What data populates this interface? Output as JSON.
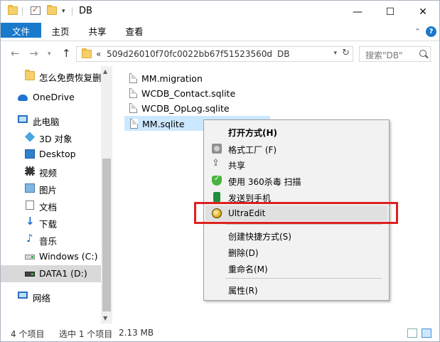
{
  "window": {
    "title": "DB",
    "controls": {
      "minimize": "—",
      "maximize": "☐",
      "close": "✕"
    }
  },
  "ribbon": {
    "tabs": [
      "文件",
      "主页",
      "共享",
      "查看"
    ],
    "collapse_icon": "chevron-up-icon",
    "help": "?"
  },
  "address": {
    "chevron": "«",
    "segments": [
      "509d26010f70fc0022bb67f51523560d",
      "DB"
    ],
    "separator": "›"
  },
  "search": {
    "placeholder": "搜索\"DB\""
  },
  "nav_pane": {
    "items": [
      {
        "label": "怎么免费恢复删",
        "icon": "folder-icon"
      },
      {
        "label": "OneDrive",
        "icon": "onedrive-icon"
      },
      {
        "label": "此电脑",
        "icon": "computer-icon"
      },
      {
        "label": "3D 对象",
        "icon": "3d-objects-icon"
      },
      {
        "label": "Desktop",
        "icon": "desktop-icon"
      },
      {
        "label": "视频",
        "icon": "video-icon"
      },
      {
        "label": "图片",
        "icon": "pictures-icon"
      },
      {
        "label": "文档",
        "icon": "documents-icon"
      },
      {
        "label": "下载",
        "icon": "download-icon"
      },
      {
        "label": "音乐",
        "icon": "music-icon"
      },
      {
        "label": "Windows (C:)",
        "icon": "drive-icon"
      },
      {
        "label": "DATA1 (D:)",
        "icon": "drive-icon",
        "selected": true
      },
      {
        "label": "网络",
        "icon": "network-icon"
      }
    ]
  },
  "files": [
    {
      "name": "MM.migration"
    },
    {
      "name": "WCDB_Contact.sqlite"
    },
    {
      "name": "WCDB_OpLog.sqlite"
    },
    {
      "name": "MM.sqlite",
      "selected": true
    }
  ],
  "context_menu": {
    "items": [
      {
        "label": "打开方式(H)",
        "bold": true,
        "icon": ""
      },
      {
        "label": "格式工厂 (F)",
        "icon": "format-factory-icon"
      },
      {
        "label": "共享",
        "icon": "share-icon"
      },
      {
        "label": "使用 360杀毒 扫描",
        "icon": "360-antivirus-icon"
      },
      {
        "label": "发送到手机",
        "icon": "send-to-phone-icon"
      },
      {
        "label": "UltraEdit",
        "icon": "ultraedit-icon",
        "highlighted": true
      },
      {
        "label": "创建快捷方式(S)",
        "icon": ""
      },
      {
        "label": "删除(D)",
        "icon": ""
      },
      {
        "label": "重命名(M)",
        "icon": ""
      },
      {
        "label": "属性(R)",
        "icon": ""
      }
    ]
  },
  "status": {
    "item_count": "4 个项目",
    "selection": "选中 1 个项目",
    "size": "2.13 MB"
  },
  "colors": {
    "accent": "#1979ca",
    "selection": "#cce8ff",
    "highlight_box": "#e02020"
  }
}
